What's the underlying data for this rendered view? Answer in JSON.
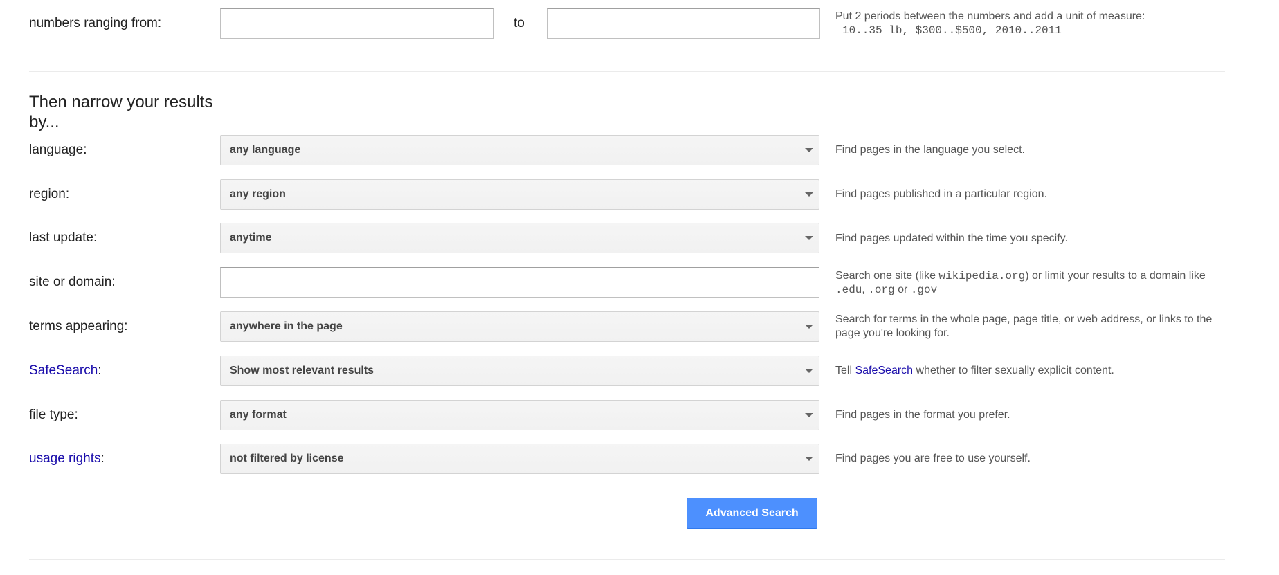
{
  "numbers": {
    "label": "numbers ranging from:",
    "from_value": "",
    "to_label": "to",
    "to_value": "",
    "help_line1": "Put 2 periods between the numbers and add a unit of measure:",
    "help_example": "10..35 lb, $300..$500, 2010..2011"
  },
  "section_title": "Then narrow your results by...",
  "language": {
    "label": "language:",
    "value": "any language",
    "help": "Find pages in the language you select."
  },
  "region": {
    "label": "region:",
    "value": "any region",
    "help": "Find pages published in a particular region."
  },
  "last_update": {
    "label": "last update:",
    "value": "anytime",
    "help": "Find pages updated within the time you specify."
  },
  "site_domain": {
    "label": "site or domain:",
    "value": "",
    "help_prefix": "Search one site (like ",
    "help_example": "wikipedia.org",
    "help_middle": ") or limit your results to a domain like ",
    "help_edu": ".edu",
    "help_sep": ", ",
    "help_org": ".org",
    "help_or": " or ",
    "help_gov": ".gov"
  },
  "terms": {
    "label": "terms appearing:",
    "value": "anywhere in the page",
    "help": "Search for terms in the whole page, page title, or web address, or links to the page you're looking for."
  },
  "safesearch": {
    "label_link": "SafeSearch",
    "label_colon": ":",
    "value": "Show most relevant results",
    "help_prefix": "Tell ",
    "help_link": "SafeSearch",
    "help_suffix": " whether to filter sexually explicit content."
  },
  "file_type": {
    "label": "file type:",
    "value": "any format",
    "help": "Find pages in the format you prefer."
  },
  "usage_rights": {
    "label_link": "usage rights",
    "label_colon": ":",
    "value": "not filtered by license",
    "help": "Find pages you are free to use yourself."
  },
  "submit": {
    "label": "Advanced Search"
  },
  "colors": {
    "link": "#1a0dab",
    "button": "#4d90fe",
    "divider": "#ebebeb"
  }
}
